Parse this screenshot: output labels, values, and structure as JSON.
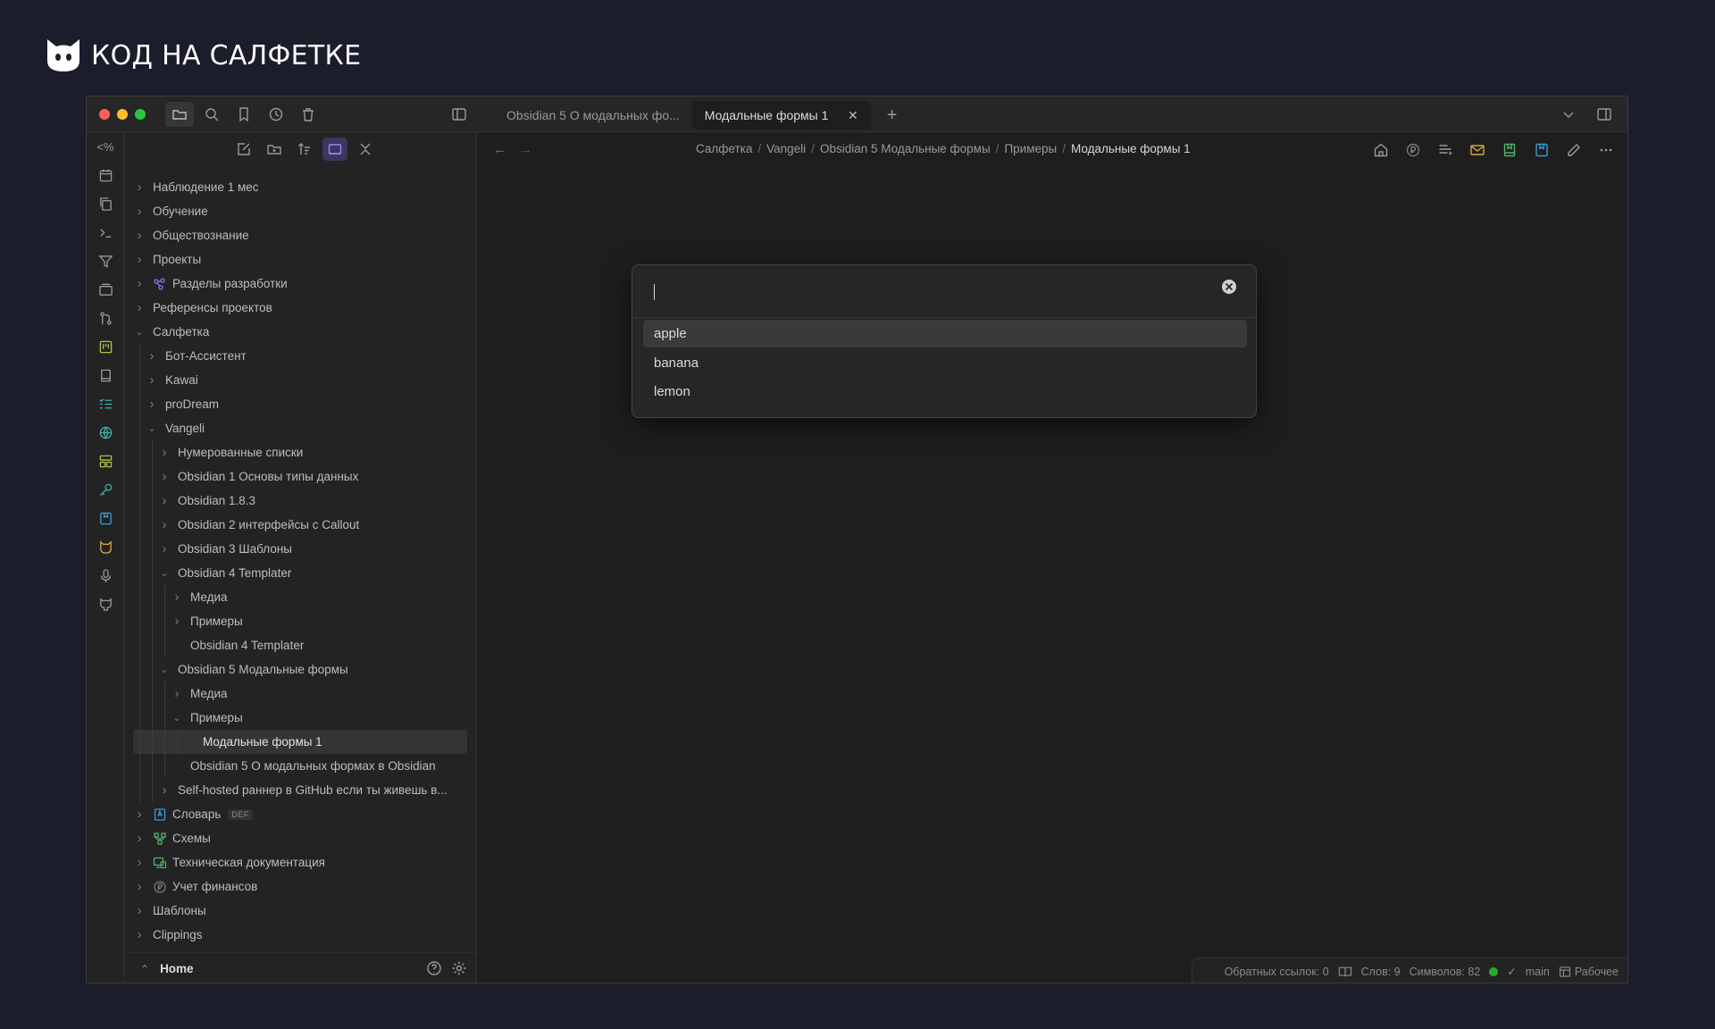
{
  "brand": {
    "name": "КОД НА САЛФЕТКЕ",
    "logo_icon": "cat-head-icon"
  },
  "window": {
    "traffic_lights": [
      "#ff5f57",
      "#febc2e",
      "#28c840"
    ],
    "titlebar_icons": [
      "folder-icon",
      "search-icon",
      "bookmark-icon",
      "clock-icon",
      "trash-icon"
    ],
    "tabs": [
      {
        "label": "Obsidian 5 О модальных фо...",
        "active": false
      },
      {
        "label": "Модальные формы 1",
        "active": true
      }
    ]
  },
  "ribbon": {
    "top_label": "<%",
    "icons": [
      "calendar-icon",
      "copy-icon",
      "terminal-icon",
      "filter-icon",
      "layers-icon",
      "git-icon",
      "kanban-icon",
      "book-icon",
      "checklist-icon",
      "globe-icon",
      "dashboard-icon",
      "key-icon",
      "bookmark-blue-icon",
      "cat-icon",
      "mic-icon",
      "github-icon"
    ]
  },
  "sidebar": {
    "toolbar_icons": [
      "new-note-icon",
      "new-folder-icon",
      "sort-icon",
      "auto-reveal-icon",
      "collapse-all-icon"
    ],
    "tree": [
      {
        "label": "Наблюдение 1 мес",
        "depth": 0,
        "chev": "right"
      },
      {
        "label": "Обучение",
        "depth": 0,
        "chev": "right"
      },
      {
        "label": "Обществознание",
        "depth": 0,
        "chev": "right"
      },
      {
        "label": "Проекты",
        "depth": 0,
        "chev": "right"
      },
      {
        "label": "Разделы разработки",
        "depth": 0,
        "chev": "right",
        "icon": "sections-icon"
      },
      {
        "label": "Референсы проектов",
        "depth": 0,
        "chev": "right"
      },
      {
        "label": "Салфетка",
        "depth": 0,
        "chev": "down"
      },
      {
        "label": "Бот-Ассистент",
        "depth": 1,
        "chev": "right"
      },
      {
        "label": "Kawai",
        "depth": 1,
        "chev": "right"
      },
      {
        "label": "proDream",
        "depth": 1,
        "chev": "right"
      },
      {
        "label": "Vangeli",
        "depth": 1,
        "chev": "down"
      },
      {
        "label": "Нумерованные списки",
        "depth": 2,
        "chev": "right"
      },
      {
        "label": "Obsidian 1 Основы типы данных",
        "depth": 2,
        "chev": "right"
      },
      {
        "label": "Obsidian 1.8.3",
        "depth": 2,
        "chev": "right"
      },
      {
        "label": "Obsidian 2 интерфейсы с Callout",
        "depth": 2,
        "chev": "right"
      },
      {
        "label": "Obsidian 3 Шаблоны",
        "depth": 2,
        "chev": "right"
      },
      {
        "label": "Obsidian 4 Templater",
        "depth": 2,
        "chev": "down"
      },
      {
        "label": "Медиа",
        "depth": 3,
        "chev": "right"
      },
      {
        "label": "Примеры",
        "depth": 3,
        "chev": "right"
      },
      {
        "label": "Obsidian 4 Templater",
        "depth": 3,
        "chev": "none"
      },
      {
        "label": "Obsidian 5 Модальные формы",
        "depth": 2,
        "chev": "down"
      },
      {
        "label": "Медиа",
        "depth": 3,
        "chev": "right"
      },
      {
        "label": "Примеры",
        "depth": 3,
        "chev": "down"
      },
      {
        "label": "Модальные формы 1",
        "depth": 4,
        "chev": "none",
        "selected": true
      },
      {
        "label": "Obsidian 5 О модальных формах в Obsidian",
        "depth": 3,
        "chev": "none"
      },
      {
        "label": "Self-hosted раннер в GitHub если ты живешь в...",
        "depth": 2,
        "chev": "right"
      },
      {
        "label": "Словарь",
        "depth": 0,
        "chev": "right",
        "icon": "dictionary-icon",
        "tag": "DEF"
      },
      {
        "label": "Схемы",
        "depth": 0,
        "chev": "right",
        "icon": "schemes-icon"
      },
      {
        "label": "Техническая документация",
        "depth": 0,
        "chev": "right",
        "icon": "tech-docs-icon"
      },
      {
        "label": "Учет финансов",
        "depth": 0,
        "chev": "right",
        "icon": "finance-icon"
      },
      {
        "label": "Шаблоны",
        "depth": 0,
        "chev": "right"
      },
      {
        "label": "Clippings",
        "depth": 0,
        "chev": "right"
      }
    ],
    "footer": {
      "vault": "Home"
    }
  },
  "main": {
    "breadcrumb": [
      "Салфетка",
      "Vangeli",
      "Obsidian 5 Модальные формы",
      "Примеры"
    ],
    "breadcrumb_current": "Модальные формы 1",
    "view_actions": [
      "home-icon",
      "money-icon",
      "outline-icon",
      "mail-icon",
      "book-green-icon",
      "bookmark-blue-icon",
      "edit-icon",
      "more-icon"
    ]
  },
  "modal": {
    "input_value": "",
    "suggestions": [
      {
        "label": "apple",
        "selected": true
      },
      {
        "label": "banana",
        "selected": false
      },
      {
        "label": "lemon",
        "selected": false
      }
    ]
  },
  "status": {
    "backlinks": "Обратных ссылок: 0",
    "words": "Слов: 9",
    "chars": "Символов: 82",
    "branch": "main",
    "workspace": "Рабочее"
  }
}
